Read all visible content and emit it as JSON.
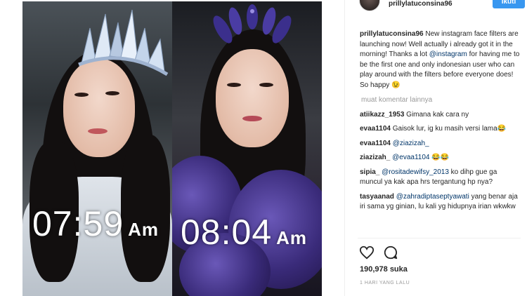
{
  "post": {
    "username": "prillylatuconsina96",
    "follow_label": "Ikuti",
    "photos": [
      {
        "time": "07:59",
        "ampm": "Am"
      },
      {
        "time": "08:04",
        "ampm": "Am"
      }
    ],
    "caption": {
      "username": "prillylatuconsina96",
      "text_before": " New instagram face filters are launching now! Well actually i already got it in the morning! Thanks a lot ",
      "mention": "@instagram",
      "text_after": " for having me to be the first one and only indonesian user who can play around with the filters before everyone does! So happy 😉"
    },
    "more_comments_label": "muat komentar lainnya",
    "comments": [
      {
        "username": "atiikazz_1953",
        "mention": "",
        "text": " Gimana kak cara ny"
      },
      {
        "username": "evaa1104",
        "mention": "",
        "text": " Gaisok lur, ig ku masih versi lama😂"
      },
      {
        "username": "evaa1104",
        "mention": "@ziazizah_",
        "text": ""
      },
      {
        "username": "ziazizah_",
        "mention": "@evaa1104",
        "text": " 😂😂"
      },
      {
        "username": "sipia_",
        "mention": "@rositadewifsy_2013",
        "text": " ko dihp gue ga muncul ya kak apa hrs tergantung hp nya?"
      },
      {
        "username": "tasyaanad",
        "mention": "@zahradiptaseptyawati",
        "text": " yang benar aja iri sama yg ginian, lu kali yg hidupnya irian wkwkw"
      }
    ],
    "likes": "190,978 suka",
    "posted_ago": "1 HARI YANG LALU",
    "icons": [
      "heart-icon",
      "comment-icon"
    ]
  }
}
